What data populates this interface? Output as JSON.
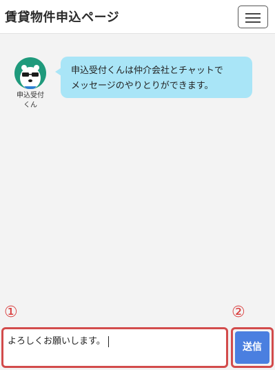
{
  "header": {
    "title": "賃貸物件申込ページ",
    "menu_icon": "hamburger-menu-icon"
  },
  "chat": {
    "agent_name_line1": "申込受付",
    "agent_name_line2": "くん",
    "avatar_icon": "bear-with-glasses-icon",
    "message_line1": "申込受付くんは仲介会社とチャットで",
    "message_line2": "メッセージのやりとりができます。",
    "bubble_color": "#a9e5f7"
  },
  "annotations": {
    "input_marker": "①",
    "send_marker": "②",
    "highlight_color": "#d24b4b"
  },
  "composer": {
    "input_value": "よろしくお願いします。",
    "send_label": "送信",
    "send_color": "#4a7fe0"
  }
}
